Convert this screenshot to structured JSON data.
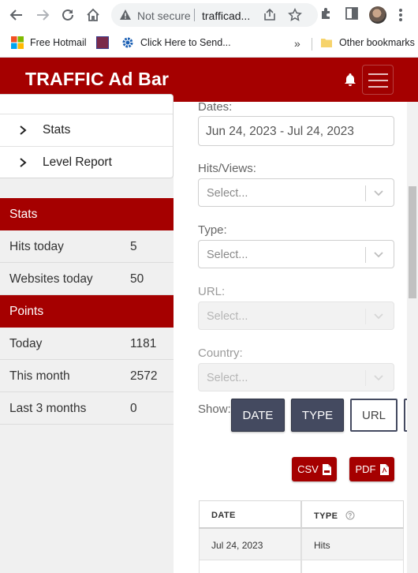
{
  "browser": {
    "security_label": "Not secure",
    "url_text": "trafficad...",
    "bookmarks": [
      {
        "label": "Free Hotmail"
      },
      {
        "label": ""
      },
      {
        "label": "Click Here to Send..."
      }
    ],
    "more_bookmarks": "»",
    "other_bookmarks": "Other bookmarks"
  },
  "header": {
    "brand": "TRAFFIC Ad Bar"
  },
  "sidebar": {
    "menu": [
      {
        "label": "Stats"
      },
      {
        "label": "Level Report"
      }
    ],
    "stats_title": "Stats",
    "stats_rows": [
      {
        "label": "Hits today",
        "value": "5"
      },
      {
        "label": "Websites today",
        "value": "50"
      }
    ],
    "points_title": "Points",
    "points_rows": [
      {
        "label": "Today",
        "value": "1181"
      },
      {
        "label": "This month",
        "value": "2572"
      },
      {
        "label": "Last 3 months",
        "value": "0"
      }
    ]
  },
  "filters": {
    "dates_label": "Dates:",
    "dates_value": "Jun 24, 2023 - Jul 24, 2023",
    "hits_label": "Hits/Views:",
    "hits_placeholder": "Select...",
    "type_label": "Type:",
    "type_placeholder": "Select...",
    "url_label": "URL:",
    "url_placeholder": "Select...",
    "country_label": "Country:",
    "country_placeholder": "Select...",
    "show_label": "Show:",
    "toggles": [
      {
        "label": "DATE",
        "active": true
      },
      {
        "label": "TYPE",
        "active": true
      },
      {
        "label": "URL",
        "active": false
      }
    ],
    "csv_label": "CSV",
    "pdf_label": "PDF"
  },
  "table": {
    "columns": [
      "DATE",
      "TYPE"
    ],
    "rows": [
      [
        "Jul 24, 2023",
        "Hits"
      ],
      [
        "",
        ""
      ]
    ]
  },
  "colors": {
    "brand_red": "#a50000",
    "toggle_dark": "#444a60"
  }
}
